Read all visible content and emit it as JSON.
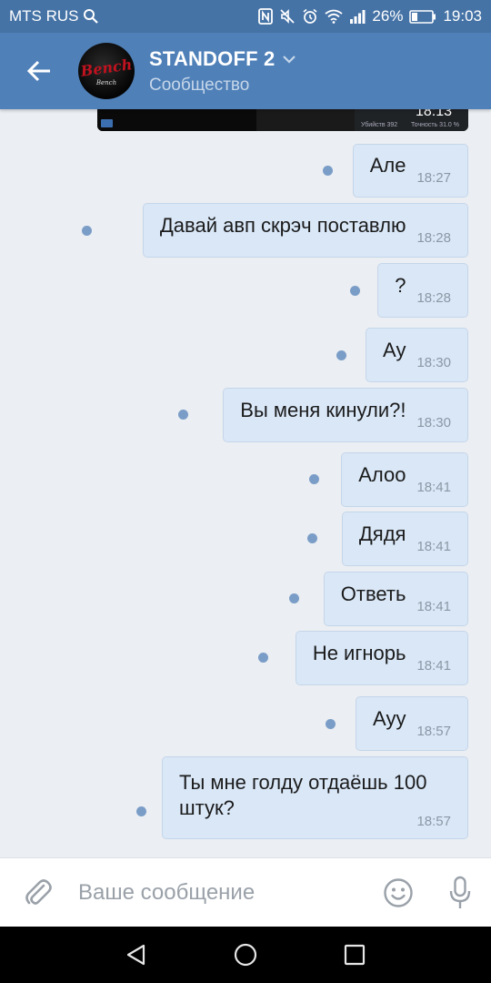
{
  "status_bar": {
    "carrier": "MTS RUS",
    "battery": "26%",
    "time": "19:03"
  },
  "header": {
    "title": "STANDOFF 2",
    "subtitle": "Сообщество",
    "avatar_text": "Bench",
    "avatar_small_text": "Bench"
  },
  "preview": {
    "time": "18:13",
    "stat_kills": "Убийств   392",
    "stat_accuracy": "Точность 31.0 %"
  },
  "messages": [
    {
      "text": "Але",
      "time": "18:27"
    },
    {
      "text": "Давай авп скрэч поставлю",
      "time": "18:28"
    },
    {
      "text": "?",
      "time": "18:28"
    },
    {
      "text": "Ау",
      "time": "18:30"
    },
    {
      "text": "Вы меня кинули?!",
      "time": "18:30"
    },
    {
      "text": "Алоо",
      "time": "18:41"
    },
    {
      "text": "Дядя",
      "time": "18:41"
    },
    {
      "text": "Ответь",
      "time": "18:41"
    },
    {
      "text": "Не игнорь",
      "time": "18:41"
    },
    {
      "text": "Ауу",
      "time": "18:57"
    },
    {
      "text": "Ты мне голду отдаёшь 100\nштук?",
      "time": "18:57"
    }
  ],
  "input": {
    "placeholder": "Ваше сообщение"
  },
  "icons": {
    "back": "arrow-left-icon",
    "attach": "paperclip-icon",
    "emoji": "smiley-icon",
    "mic": "microphone-icon",
    "nav_back": "triangle-back-icon",
    "nav_home": "circle-home-icon",
    "nav_recent": "square-recent-icon"
  },
  "colors": {
    "header": "#4f80b8",
    "status_bar": "#4673a6",
    "bubble": "#d9e7f7",
    "unread_dot": "#7a9dc8",
    "background": "#ebeef2"
  }
}
